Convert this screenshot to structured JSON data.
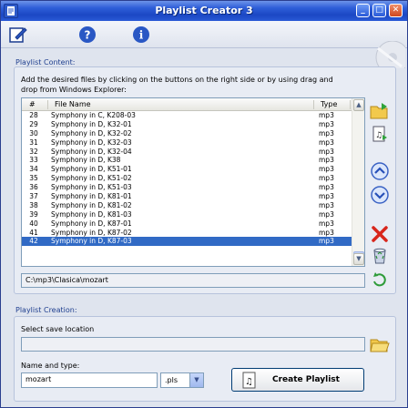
{
  "window": {
    "title": "Playlist Creator 3"
  },
  "toolbar": {
    "items": [
      {
        "icon": "edit-icon"
      },
      {
        "icon": "help-icon"
      },
      {
        "icon": "info-icon"
      }
    ]
  },
  "content_group": {
    "title": "Playlist Content:",
    "hint": "Add the desired files by clicking on the buttons on the right side or by using drag and drop from Windows Explorer:",
    "columns": [
      "#",
      "File Name",
      "Type"
    ],
    "rows": [
      {
        "num": "28",
        "name": "Symphony in C, K208-03",
        "type": "mp3"
      },
      {
        "num": "29",
        "name": "Symphony in D, K32-01",
        "type": "mp3"
      },
      {
        "num": "30",
        "name": "Symphony in D, K32-02",
        "type": "mp3"
      },
      {
        "num": "31",
        "name": "Symphony in D, K32-03",
        "type": "mp3"
      },
      {
        "num": "32",
        "name": "Symphony in D, K32-04",
        "type": "mp3"
      },
      {
        "num": "33",
        "name": "Symphony in D, K38",
        "type": "mp3"
      },
      {
        "num": "34",
        "name": "Symphony in D, K51-01",
        "type": "mp3"
      },
      {
        "num": "35",
        "name": "Symphony in D, K51-02",
        "type": "mp3"
      },
      {
        "num": "36",
        "name": "Symphony in D, K51-03",
        "type": "mp3"
      },
      {
        "num": "37",
        "name": "Symphony in D, K81-01",
        "type": "mp3"
      },
      {
        "num": "38",
        "name": "Symphony in D, K81-02",
        "type": "mp3"
      },
      {
        "num": "39",
        "name": "Symphony in D, K81-03",
        "type": "mp3"
      },
      {
        "num": "40",
        "name": "Symphony in D, K87-01",
        "type": "mp3"
      },
      {
        "num": "41",
        "name": "Symphony in D, K87-02",
        "type": "mp3"
      },
      {
        "num": "42",
        "name": "Symphony in D, K87-03",
        "type": "mp3"
      }
    ],
    "selected_index": 14,
    "folder_path": "C:\\mp3\\Clasica\\mozart",
    "side_buttons": [
      "add-folder-icon",
      "add-file-icon",
      "move-up-icon",
      "move-down-icon",
      "remove-icon",
      "clear-all-icon"
    ]
  },
  "creation_group": {
    "title": "Playlist Creation:",
    "save_location_label": "Select save location",
    "save_location_value": "",
    "name_type_label": "Name and type:",
    "name_value": "mozart",
    "type_value": ".pls",
    "create_button": "Create Playlist"
  }
}
